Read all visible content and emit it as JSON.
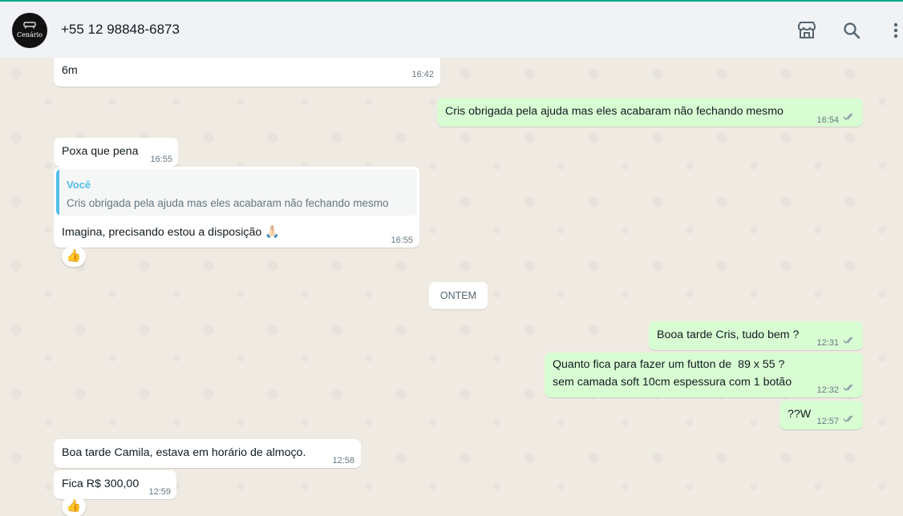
{
  "header": {
    "avatar_text": "Cenário",
    "contact": "+55 12 98848-6873",
    "icons": [
      "shop-icon",
      "search-icon",
      "menu-icon"
    ]
  },
  "colors": {
    "incoming": "#ffffff",
    "outgoing": "#d9fdd3",
    "accent": "#00a884",
    "tick": "#8696a0"
  },
  "messages": [
    {
      "dir": "in",
      "text": "6m",
      "time": "16:42"
    },
    {
      "dir": "out",
      "text": "Cris obrigada pela ajuda mas eles acabaram não fechando mesmo",
      "time": "16:54"
    },
    {
      "dir": "in",
      "text": "Poxa que pena",
      "time": "16:55"
    },
    {
      "dir": "in",
      "quote_author": "Você",
      "quote_text": "Cris obrigada pela ajuda mas eles acabaram não fechando mesmo",
      "text": "Imagina, precisando estou a disposição",
      "emoji": "🙏🏻",
      "time": "16:55",
      "reaction": "👍"
    },
    {
      "dir": "out",
      "text": "Booa tarde Cris, tudo bem ?",
      "time": "12:31"
    },
    {
      "dir": "out",
      "text": "Quanto fica para fazer um futton de  89 x 55 ?",
      "text2": "sem camada soft 10cm espessura com 1 botão",
      "time": "12:32"
    },
    {
      "dir": "out",
      "text": "??W",
      "time": "12:57"
    },
    {
      "dir": "in",
      "text": "Boa tarde Camila, estava em horário de almoço.",
      "time": "12:58"
    },
    {
      "dir": "in",
      "text": "Fica R$ 300,00",
      "time": "12:59",
      "reaction": "👍"
    }
  ],
  "date_divider": "ONTEM"
}
